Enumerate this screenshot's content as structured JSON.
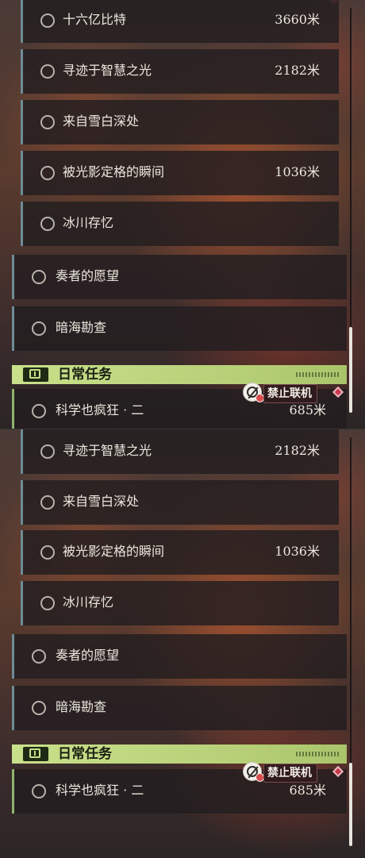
{
  "top_view": {
    "sub_quests": [
      {
        "label": "十六亿比特",
        "distance": "3660米"
      },
      {
        "label": "寻迹于智慧之光",
        "distance": "2182米"
      },
      {
        "label": "来自雪白深处",
        "distance": ""
      },
      {
        "label": "被光影定格的瞬间",
        "distance": "1036米"
      },
      {
        "label": "冰川存忆",
        "distance": ""
      }
    ],
    "main_quests": [
      {
        "label": "奏者的愿望"
      },
      {
        "label": "暗海勘查"
      }
    ],
    "daily_header": "日常任务",
    "no_multiplayer": "禁止联机",
    "daily_quest": {
      "label": "科学也疯狂 · 二",
      "distance": "685米"
    }
  },
  "bottom_view": {
    "sub_quests": [
      {
        "label": "寻迹于智慧之光",
        "distance": "2182米"
      },
      {
        "label": "来自雪白深处",
        "distance": ""
      },
      {
        "label": "被光影定格的瞬间",
        "distance": "1036米"
      },
      {
        "label": "冰川存忆",
        "distance": ""
      }
    ],
    "main_quests": [
      {
        "label": "奏者的愿望"
      },
      {
        "label": "暗海勘查"
      }
    ],
    "daily_header": "日常任务",
    "no_multiplayer": "禁止联机",
    "daily_quest": {
      "label": "科学也疯狂 · 二",
      "distance": "685米"
    }
  },
  "icons": {
    "quest_status": "circle-outline-icon",
    "daily_badge": "exclamation-icon",
    "no_multiplayer": "globe-ban-icon",
    "marker": "red-diamond-icon"
  },
  "colors": {
    "daily_header_bg": "#c9e08a",
    "row_bg": "#221d20",
    "quest_border": "#6e8c96",
    "daily_border": "#8db36e",
    "ban_red": "#d94c4c"
  }
}
